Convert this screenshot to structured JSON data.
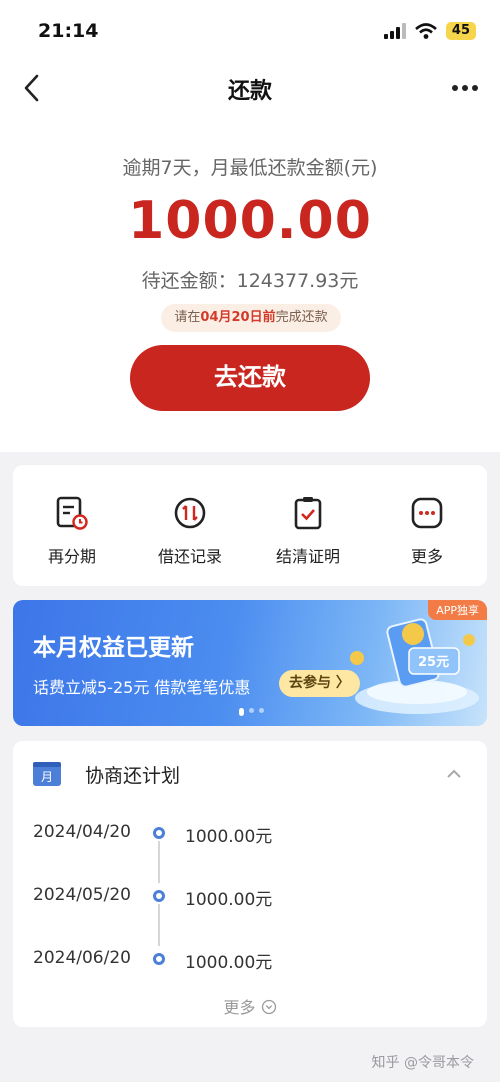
{
  "status": {
    "time": "21:14",
    "battery": "45"
  },
  "nav": {
    "title": "还款"
  },
  "summary": {
    "overdue_label": "逾期7天，月最低还款金额(元)",
    "amount": "1000.00",
    "pending_label": "待还金额：124377.93元",
    "deadline_prefix": "请在",
    "deadline_date": "04月20日前",
    "deadline_suffix": "完成还款",
    "repay_button": "去还款"
  },
  "actions": [
    {
      "label": "再分期",
      "icon": "reinstallment-icon"
    },
    {
      "label": "借还记录",
      "icon": "records-icon"
    },
    {
      "label": "结清证明",
      "icon": "settlement-certificate-icon"
    },
    {
      "label": "更多",
      "icon": "more-dots-icon"
    }
  ],
  "banner": {
    "tag": "APP独享",
    "title": "本月权益已更新",
    "subtitle": "话费立减5-25元 借款笔笔优惠",
    "join_button": "去参与 〉",
    "coupon": "25元"
  },
  "plan": {
    "title": "协商还计划",
    "calendar_label": "月",
    "rows": [
      {
        "date": "2024/04/20",
        "amount": "1000.00元"
      },
      {
        "date": "2024/05/20",
        "amount": "1000.00元"
      },
      {
        "date": "2024/06/20",
        "amount": "1000.00元"
      }
    ],
    "more": "更多"
  },
  "watermark": "知乎 @令哥本令",
  "colors": {
    "accent_red": "#c9261f",
    "timeline_blue": "#4b7fd8",
    "banner_blue": "#3d76e8"
  }
}
